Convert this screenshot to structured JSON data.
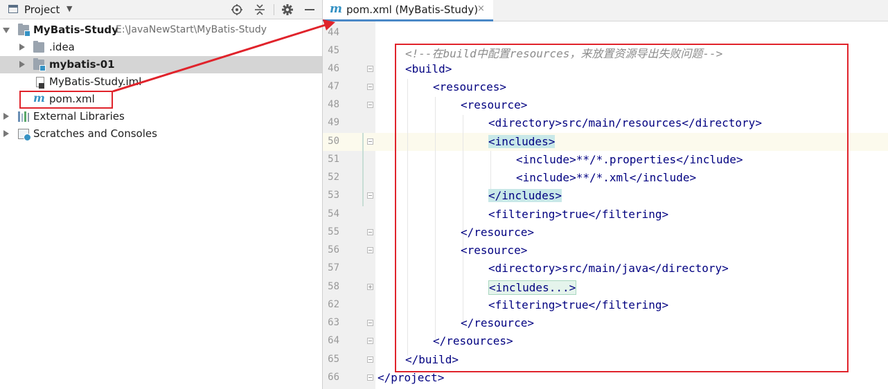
{
  "project_panel": {
    "title": "Project",
    "dropdown_glyph": "▼",
    "header_icons": [
      "project-view-icon",
      "locate-icon",
      "collapse-all-icon",
      "gear-icon",
      "hide-icon"
    ],
    "tree": [
      {
        "label": "MyBatis-Study",
        "path": "E:\\JavaNewStart\\MyBatis-Study",
        "icon": "module-folder-icon",
        "expanded": true,
        "bold": true
      },
      {
        "label": ".idea",
        "icon": "folder-icon",
        "expanded": false
      },
      {
        "label": "mybatis-01",
        "icon": "module-folder-icon",
        "expanded": false,
        "bold": true,
        "selected": true
      },
      {
        "label": "MyBatis-Study.iml",
        "icon": "iml-file-icon"
      },
      {
        "label": "pom.xml",
        "icon": "maven-m-icon"
      },
      {
        "label": "External Libraries",
        "icon": "libraries-icon",
        "expanded": false
      },
      {
        "label": "Scratches and Consoles",
        "icon": "scratches-icon",
        "expanded": false
      }
    ]
  },
  "editor": {
    "tab": {
      "icon_glyph": "m",
      "title": "pom.xml (MyBatis-Study)",
      "close_glyph": "×"
    },
    "lines": [
      {
        "n": "44",
        "code": ""
      },
      {
        "n": "45",
        "code": "<!--在build中配置resources，来放置资源导出失败问题-->"
      },
      {
        "n": "46",
        "code": "<build>"
      },
      {
        "n": "47",
        "code": "<resources>"
      },
      {
        "n": "48",
        "code": "<resource>"
      },
      {
        "n": "49",
        "code": "<directory>src/main/resources</directory>"
      },
      {
        "n": "50",
        "code": "<includes>"
      },
      {
        "n": "51",
        "code": "<include>**/*.properties</include>"
      },
      {
        "n": "52",
        "code": "<include>**/*.xml</include>"
      },
      {
        "n": "53",
        "code": "</includes>"
      },
      {
        "n": "54",
        "code": "<filtering>true</filtering>"
      },
      {
        "n": "55",
        "code": "</resource>"
      },
      {
        "n": "56",
        "code": "<resource>"
      },
      {
        "n": "57",
        "code": "<directory>src/main/java</directory>"
      },
      {
        "n": "58",
        "code": "<includes...>"
      },
      {
        "n": "62",
        "code": "<filtering>true</filtering>"
      },
      {
        "n": "63",
        "code": "</resource>"
      },
      {
        "n": "64",
        "code": "</resources>"
      },
      {
        "n": "65",
        "code": "</build>"
      },
      {
        "n": "66",
        "code": "</project>"
      }
    ]
  },
  "annotations": {
    "color": "#e0232b"
  },
  "colors": {
    "tag": "#000080",
    "comment": "#8c8c8c",
    "accent": "#4a88c7",
    "selection": "#d5d5d5"
  }
}
